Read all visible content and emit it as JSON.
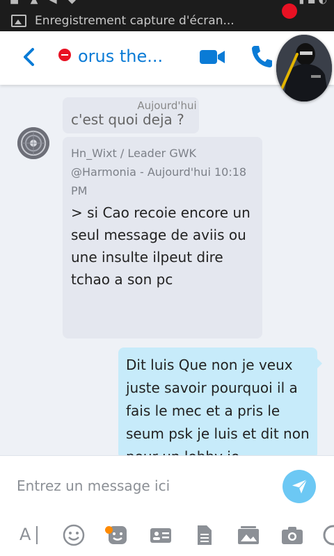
{
  "statusbar": {
    "notification_text": "Enregistrement capture d'écran..."
  },
  "header": {
    "contact_name": "orus the...",
    "presence": "busy",
    "accent_color": "#0a7bd6"
  },
  "conversation": {
    "date_separator": "Aujourd'hui",
    "previous_message_fragment": "c'est quoi deja ?",
    "incoming": {
      "quote_author": "Hn_Wixt / Leader GWK",
      "quote_source": "@Harmonia - Aujourd'hui 10:18 PM",
      "quote_text": "> si Cao recoie encore un seul message de aviis ou une insulte ilpeut dire tchao a son pc"
    },
    "outgoing": {
      "text": "Dit luis Que non je veux juste savoir pourquoi il a fais le mec et a pris le seum psk je luis et dit non pour un lobby je"
    }
  },
  "composer": {
    "placeholder": "Entrez un message ici",
    "send_color": "#6cc8f4"
  },
  "toolbar": {
    "icons": [
      "text-format-icon",
      "emoji-icon",
      "sticker-icon",
      "contact-card-icon",
      "file-icon",
      "media-icon",
      "camera-icon"
    ]
  }
}
